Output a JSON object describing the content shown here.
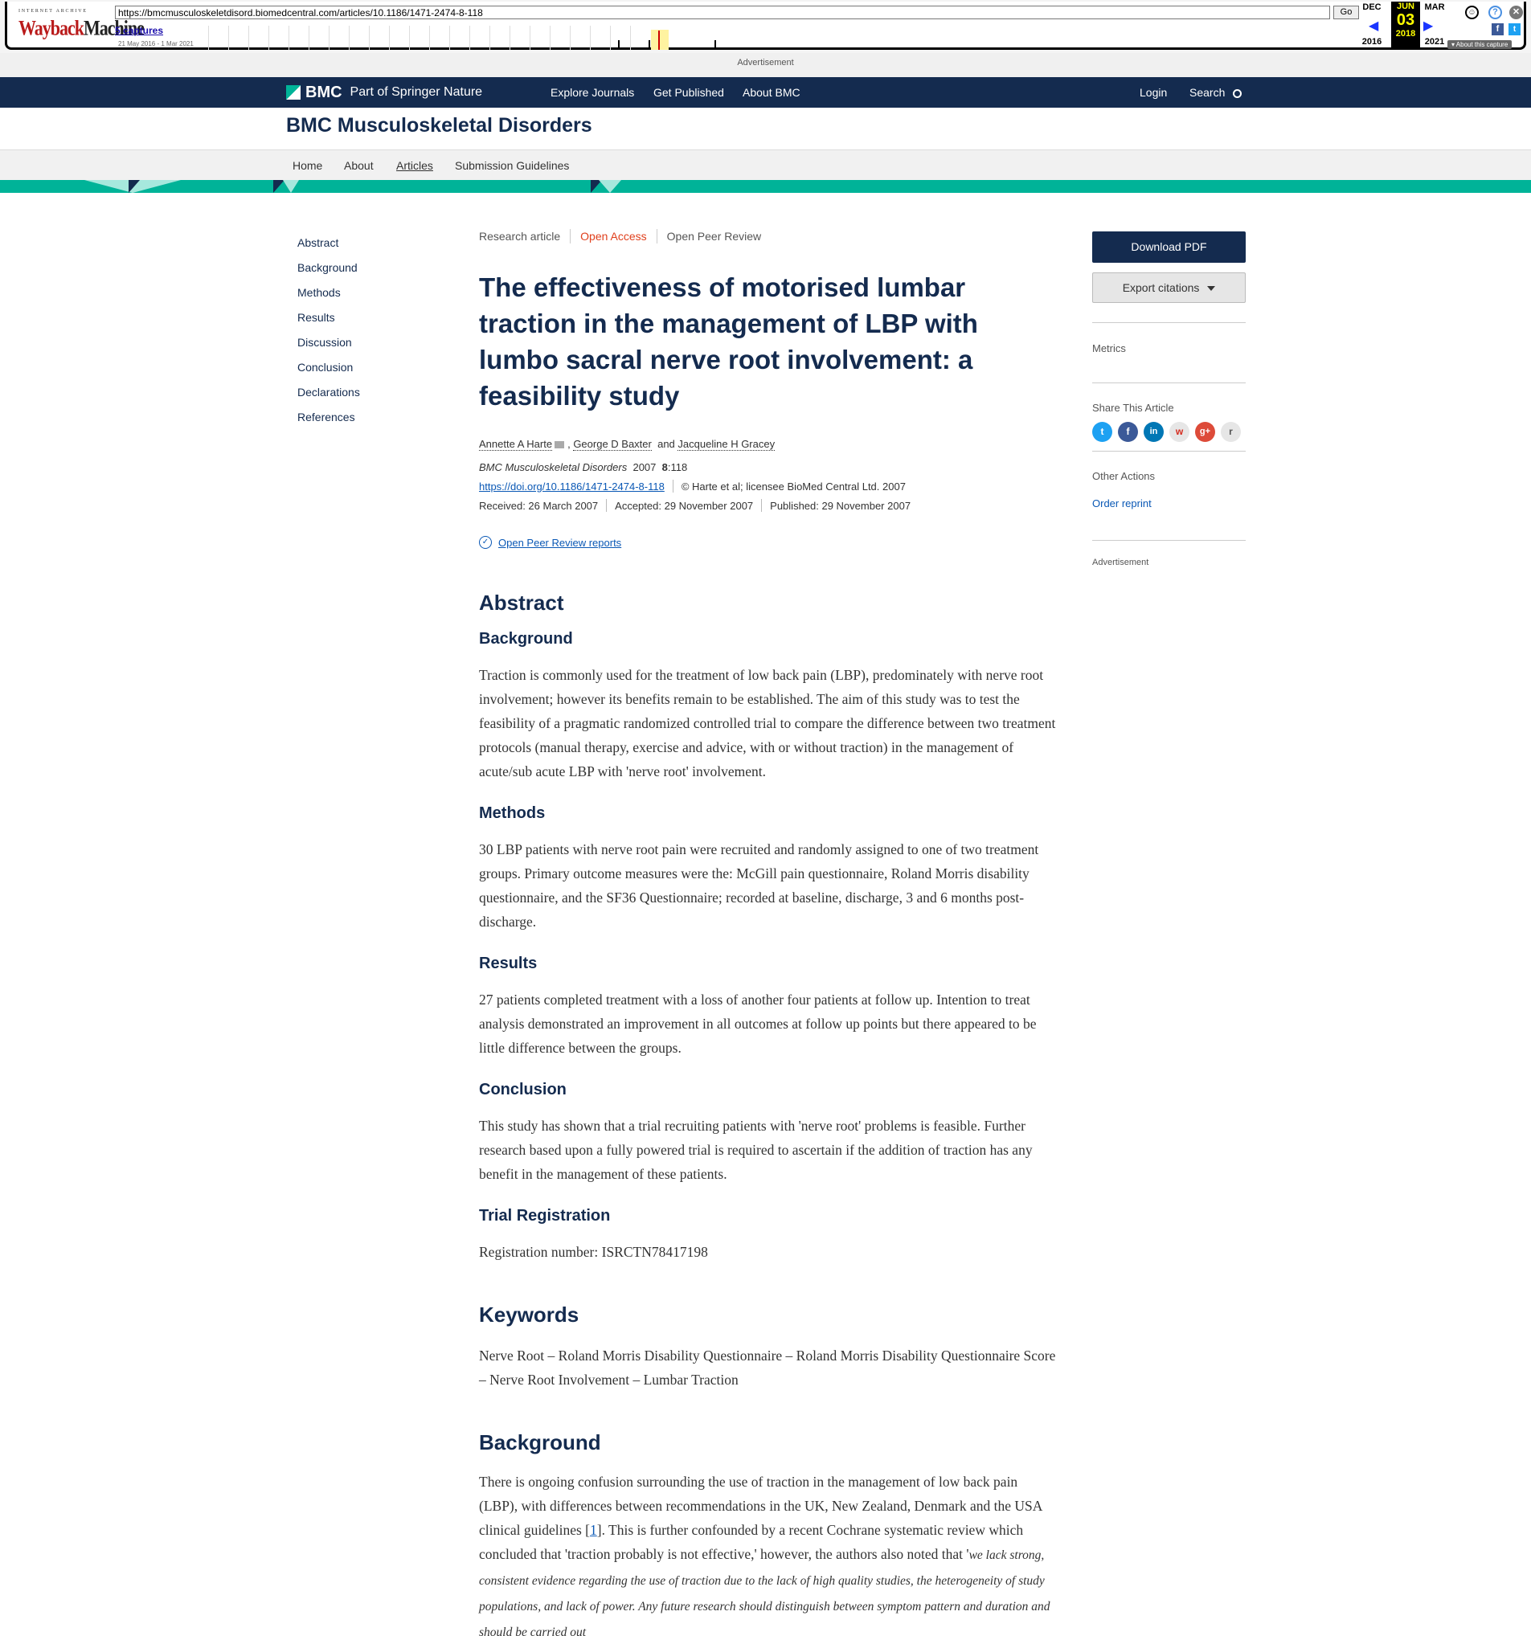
{
  "wayback": {
    "logo_top": "INTERNET ARCHIVE",
    "logo_main": "Wayback",
    "logo_second": "Machine",
    "url": "https://bmcmusculoskeletdisord.biomedcentral.com/articles/10.1186/1471-2474-8-118",
    "go_label": "Go",
    "captures": "5 captures",
    "range": "21 May 2016 - 1 Mar 2021",
    "prev_month": "DEC",
    "prev_year": "2016",
    "cur_month": "JUN",
    "cur_day": "03",
    "cur_year": "2018",
    "next_month": "MAR",
    "next_year": "2021",
    "about_capture": "About this capture"
  },
  "ad_top": "Advertisement",
  "bmc_header": {
    "logo": "BMC",
    "logo_sub": "Part of Springer Nature",
    "nav": [
      "Explore Journals",
      "Get Published",
      "About BMC"
    ],
    "login": "Login",
    "search": "Search"
  },
  "journal_title": "BMC Musculoskeletal Disorders",
  "subnav": [
    "Home",
    "About",
    "Articles",
    "Submission Guidelines"
  ],
  "toc": [
    "Abstract",
    "Background",
    "Methods",
    "Results",
    "Discussion",
    "Conclusion",
    "Declarations",
    "References"
  ],
  "article": {
    "type": "Research article",
    "open_access": "Open Access",
    "peer_review": "Open Peer Review",
    "title": "The effectiveness of motorised lumbar traction in the management of LBP with lumbo sacral nerve root involvement: a feasibility study",
    "author1": "Annette A Harte",
    "author2": "George D Baxter",
    "and": "and",
    "author3": "Jacqueline H Gracey",
    "journal": "BMC Musculoskeletal Disorders",
    "year": "2007",
    "volume": "8",
    "article_no": ":118",
    "doi": "https://doi.org/10.1186/1471-2474-8-118",
    "copyright": "©  Harte et al; licensee BioMed Central Ltd. 2007",
    "received": "Received: 26 March 2007",
    "accepted": "Accepted: 29 November 2007",
    "published": "Published: 29 November 2007",
    "peer_reports": "Open Peer Review reports"
  },
  "abstract": {
    "heading": "Abstract",
    "background_h": "Background",
    "background": "Traction is commonly used for the treatment of low back pain (LBP), predominately with nerve root involvement; however its benefits remain to be established. The aim of this study was to test the feasibility of a pragmatic randomized controlled trial to compare the difference between two treatment protocols (manual therapy, exercise and advice, with or without traction) in the management of acute/sub acute LBP with 'nerve root' involvement.",
    "methods_h": "Methods",
    "methods": "30 LBP patients with nerve root pain were recruited and randomly assigned to one of two treatment groups. Primary outcome measures were the: McGill pain questionnaire, Roland Morris disability questionnaire, and the SF36 Questionnaire; recorded at baseline, discharge, 3 and 6 months post-discharge.",
    "results_h": "Results",
    "results": "27 patients completed treatment with a loss of another four patients at follow up. Intention to treat analysis demonstrated an improvement in all outcomes at follow up points but there appeared to be little difference between the groups.",
    "conclusion_h": "Conclusion",
    "conclusion": "This study has shown that a trial recruiting patients with 'nerve root' problems is feasible. Further research based upon a fully powered trial is required to ascertain if the addition of traction has any benefit in the management of these patients.",
    "trial_h": "Trial Registration",
    "trial": "Registration number: ISRCTN78417198"
  },
  "keywords": {
    "heading": "Keywords",
    "text": "Nerve Root – Roland Morris Disability Questionnaire – Roland Morris Disability Questionnaire Score – Nerve Root Involvement – Lumbar Traction"
  },
  "background": {
    "heading": "Background",
    "text1": "There is ongoing confusion surrounding the use of traction in the management of low back pain (LBP), with differences between recommendations in the UK, New Zealand, Denmark and the USA clinical guidelines [",
    "ref": "1",
    "text2": "]. This is further confounded by a recent Cochrane systematic review which concluded that 'traction probably is not effective,' however, the authors also noted that '",
    "quote": "we lack strong, consistent evidence regarding the use of traction due to the lack of high quality studies, the heterogeneity of study populations, and lack of power. Any future research should distinguish between symptom pattern and duration and should be carried out"
  },
  "sidebar": {
    "download_pdf": "Download PDF",
    "export": "Export citations",
    "metrics": "Metrics",
    "share": "Share This Article",
    "other_actions": "Other Actions",
    "order_reprint": "Order reprint",
    "advertisement": "Advertisement"
  },
  "colors": {
    "navy": "#142b4f",
    "teal": "#00b398",
    "open_access": "#e0401d",
    "link": "#0a58b5"
  }
}
